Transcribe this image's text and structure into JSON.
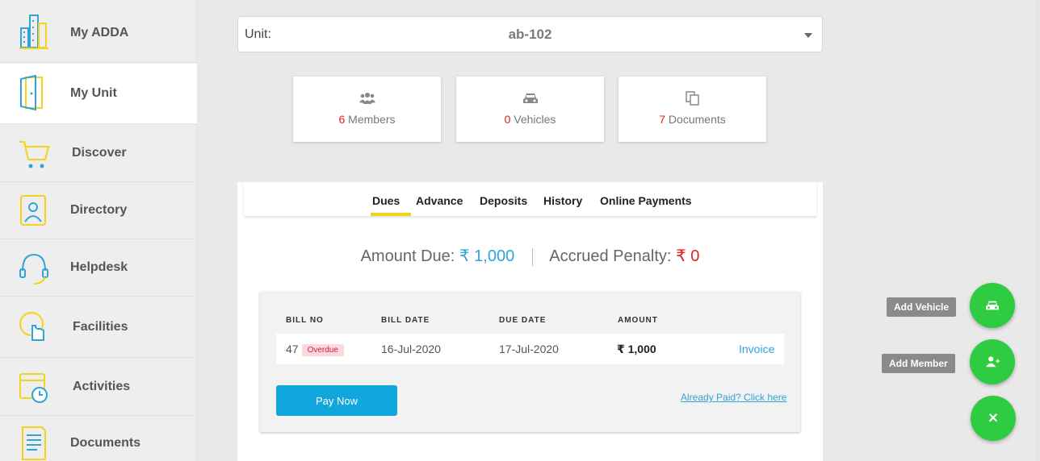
{
  "sidebar": {
    "items": [
      {
        "label": "My ADDA",
        "icon": "buildings-icon"
      },
      {
        "label": "My Unit",
        "icon": "door-icon"
      },
      {
        "label": "Discover",
        "icon": "cart-icon"
      },
      {
        "label": "Directory",
        "icon": "contact-book-icon"
      },
      {
        "label": "Helpdesk",
        "icon": "headset-icon"
      },
      {
        "label": "Facilities",
        "icon": "tap-hand-icon"
      },
      {
        "label": "Activities",
        "icon": "calendar-clock-icon"
      },
      {
        "label": "Documents",
        "icon": "document-icon"
      }
    ]
  },
  "unit": {
    "label": "Unit:",
    "value": "ab-102"
  },
  "stats": {
    "members": {
      "count": "6",
      "label": " Members"
    },
    "vehicles": {
      "count": "0",
      "label": " Vehicles"
    },
    "documents": {
      "count": "7",
      "label": " Documents"
    }
  },
  "tabs": [
    "Dues",
    "Advance",
    "Deposits",
    "History",
    "Online Payments"
  ],
  "summary": {
    "amount_due_label": "Amount Due: ",
    "amount_due_value": "₹ 1,000",
    "penalty_label": "Accrued Penalty: ",
    "penalty_value": "₹ 0"
  },
  "bills": {
    "headers": [
      "BILL NO",
      "BILL DATE",
      "DUE DATE",
      "AMOUNT"
    ],
    "rows": [
      {
        "bill_no": "47",
        "status": "Overdue",
        "bill_date": "16-Jul-2020",
        "due_date": "17-Jul-2020",
        "amount": "₹ 1,000",
        "invoice": "Invoice"
      }
    ],
    "pay_now": "Pay Now",
    "already_paid": "Already Paid? Click here"
  },
  "fab": {
    "add_vehicle": "Add Vehicle",
    "add_member": "Add Member",
    "close_glyph": "×"
  },
  "colors": {
    "accent_yellow": "#f4d31a",
    "accent_blue": "#2ea4d8",
    "red": "#e02020",
    "fab_green": "#2ecc40",
    "pay_blue": "#12a7dc"
  }
}
